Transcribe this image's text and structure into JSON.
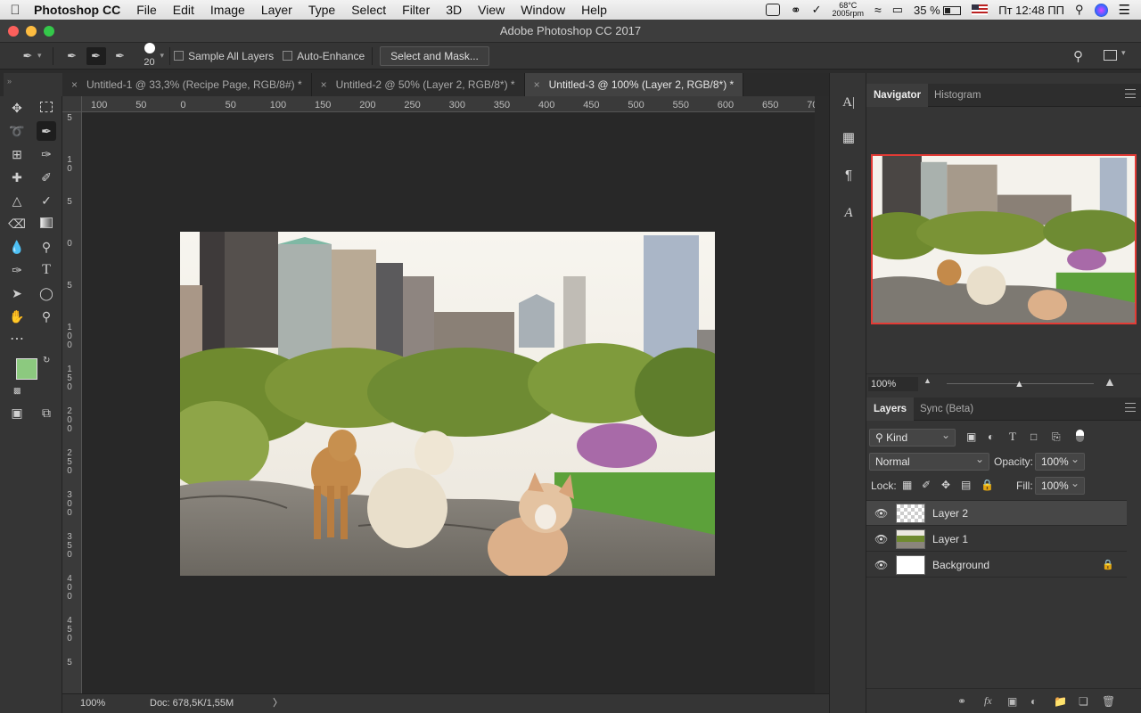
{
  "menubar": {
    "apple": "",
    "app_name": "Photoshop CC",
    "items": [
      "File",
      "Edit",
      "Image",
      "Layer",
      "Type",
      "Select",
      "Filter",
      "3D",
      "View",
      "Window",
      "Help"
    ],
    "temp": "68°C",
    "rpm": "2005rpm",
    "battery": "35 %",
    "clock": "Пт 12:48 ПП"
  },
  "window": {
    "title": "Adobe Photoshop CC 2017"
  },
  "options": {
    "brush_size": "20",
    "sample_all_layers": "Sample All Layers",
    "auto_enhance": "Auto-Enhance",
    "select_and_mask": "Select and Mask..."
  },
  "tabs": [
    {
      "label": "Untitled-1 @ 33,3% (Recipe Page, RGB/8#) *"
    },
    {
      "label": "Untitled-2 @ 50% (Layer 2, RGB/8*) *"
    },
    {
      "label": "Untitled-3 @ 100% (Layer 2, RGB/8*) *"
    }
  ],
  "ruler_h": [
    "100",
    "50",
    "0",
    "50",
    "100",
    "150",
    "200",
    "250",
    "300",
    "350",
    "400",
    "450",
    "500",
    "550",
    "600",
    "650",
    "70"
  ],
  "ruler_v": [
    "5",
    "1 0",
    "5",
    "0",
    "5",
    "1 0 0",
    "1 5 0",
    "2 0 0",
    "2 5 0",
    "3 0 0",
    "3 5 0",
    "4 0 0",
    "4 5 0",
    "5"
  ],
  "status": {
    "zoom": "100%",
    "doc": "Doc: 678,5K/1,55M",
    "arrow": "〉"
  },
  "colors": {
    "foreground": "#8cc97f",
    "background": "#ffffff",
    "accent_border": "#e33b35"
  },
  "navigator": {
    "tabs": [
      "Navigator",
      "Histogram"
    ],
    "zoom": "100%"
  },
  "layers_panel": {
    "tabs": [
      "Layers",
      "Sync (Beta)"
    ],
    "filter_kind": "Kind",
    "blend_mode": "Normal",
    "opacity_label": "Opacity:",
    "opacity_value": "100%",
    "lock_label": "Lock:",
    "fill_label": "Fill:",
    "fill_value": "100%",
    "layers": [
      {
        "name": "Layer 2",
        "selected": true
      },
      {
        "name": "Layer 1",
        "selected": false
      },
      {
        "name": "Background",
        "selected": false,
        "locked": true
      }
    ]
  }
}
